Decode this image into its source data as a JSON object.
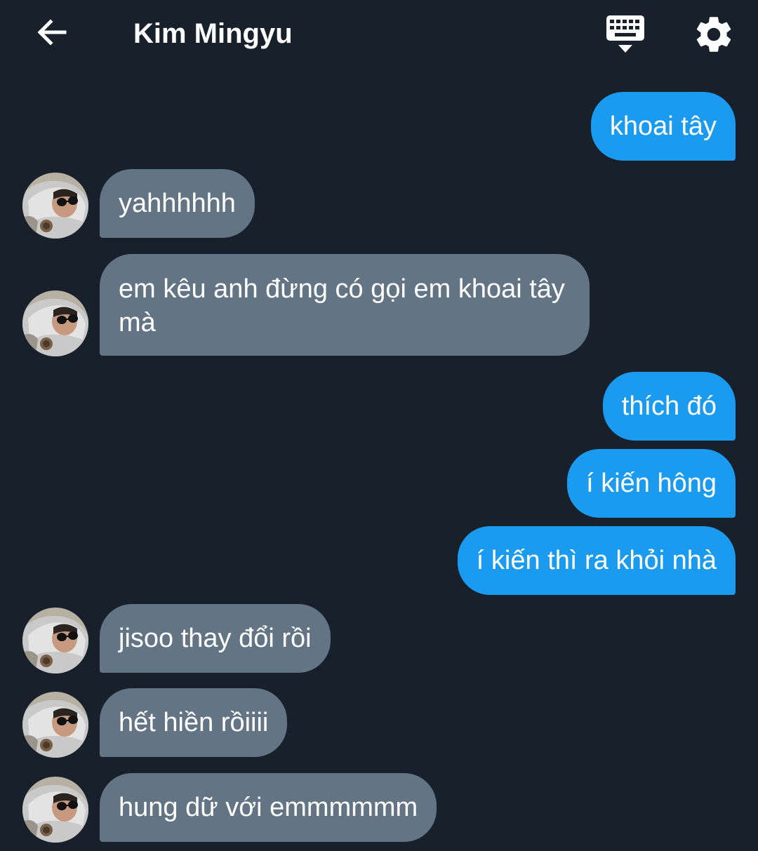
{
  "header": {
    "back_icon": "arrow-left-icon",
    "title": "Kim Mingyu",
    "keyboard_icon": "keyboard-icon",
    "settings_icon": "gear-icon"
  },
  "colors": {
    "background": "#17202b",
    "sent_bubble": "#1b9bf0",
    "received_bubble": "#637485",
    "text": "#ffffff"
  },
  "messages": [
    {
      "from": "me",
      "text": "khoai tây"
    },
    {
      "from": "contact",
      "text": "yahhhhhh"
    },
    {
      "from": "contact",
      "text": "em kêu anh đừng có gọi em khoai tây mà"
    },
    {
      "from": "me",
      "text": "thích đó"
    },
    {
      "from": "me",
      "text": "í kiến hông"
    },
    {
      "from": "me",
      "text": "í kiến thì ra khỏi nhà"
    },
    {
      "from": "contact",
      "text": "jisoo thay đổi rồi"
    },
    {
      "from": "contact",
      "text": "hết hiền rồiiii"
    },
    {
      "from": "contact",
      "text": "hung dữ với emmmmmm"
    }
  ]
}
